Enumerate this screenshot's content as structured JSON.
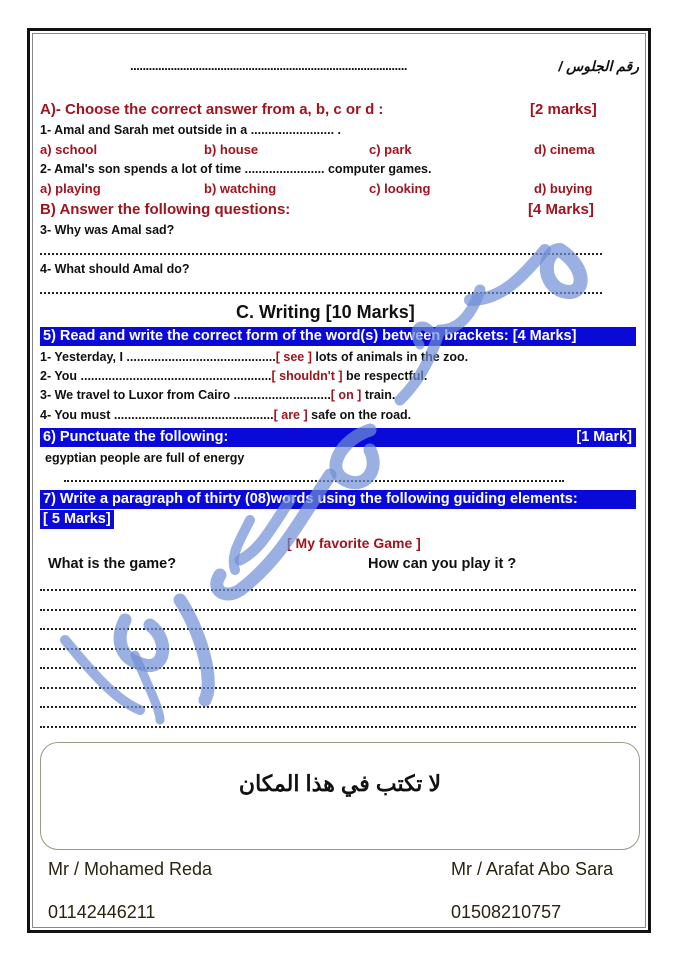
{
  "header": {
    "seat_number_label": "رقم الجلوس /",
    "seat_number_dots": "........................................................................................."
  },
  "section_a": {
    "title": "A)- Choose the correct answer from a, b, c or d :",
    "marks": "[2 marks]",
    "questions": [
      {
        "text": "1- Amal and Sarah met outside in a ........................ .",
        "options": [
          "a) school",
          "b) house",
          "c) park",
          "d) cinema"
        ]
      },
      {
        "text": "2- Amal's son spends a lot of time ....................... computer games.",
        "options": [
          "a) playing",
          "b) watching",
          "c) looking",
          "d) buying"
        ]
      }
    ]
  },
  "section_b": {
    "title": "B) Answer the following questions:",
    "marks": "[4 Marks]",
    "questions": [
      "3- Why was Amal sad?",
      "4- What should Amal do?"
    ]
  },
  "section_c": {
    "title": "C. Writing  [10 Marks]",
    "q5": {
      "title": "5) Read and write the correct form of the word(s) between brackets: [4 Marks]",
      "items": [
        {
          "before": "1- Yesterday, I ...........................................",
          "bracket": "[ see ]",
          "after": " lots of animals in the zoo."
        },
        {
          "before": "2- You .......................................................",
          "bracket": "[ shouldn't ]",
          "after": " be respectful."
        },
        {
          "before": "3- We travel to Luxor from Cairo ............................",
          "bracket": "[ on ]",
          "after": " train."
        },
        {
          "before": "4- You must ..............................................",
          "bracket": "[ are ]",
          "after": " safe on the road."
        }
      ]
    },
    "q6": {
      "title": "6)  Punctuate the following:",
      "marks": "[1 Mark]",
      "sentence": "egyptian people are full of energy"
    },
    "q7": {
      "title_line1": "7) Write a paragraph of thirty (08)words using the following guiding elements:",
      "title_line2": "[ 5 Marks]",
      "topic": "[ My favorite Game ]",
      "guide_1": "What is the game?",
      "guide_2": "How can you play it ?",
      "answer_line_count": 8
    }
  },
  "note_box": {
    "text": "لا تكتب في هذا المكان"
  },
  "footer": {
    "teacher_1": {
      "name": "Mr / Mohamed Reda",
      "phone": "01142446211"
    },
    "teacher_2": {
      "name": "Mr / Arafat Abo Sara",
      "phone": "01508210757"
    }
  },
  "colors": {
    "accent_red": "#a0141e",
    "highlight_blue": "#0a0ad8",
    "watermark_blue": "#6f8fd6"
  }
}
